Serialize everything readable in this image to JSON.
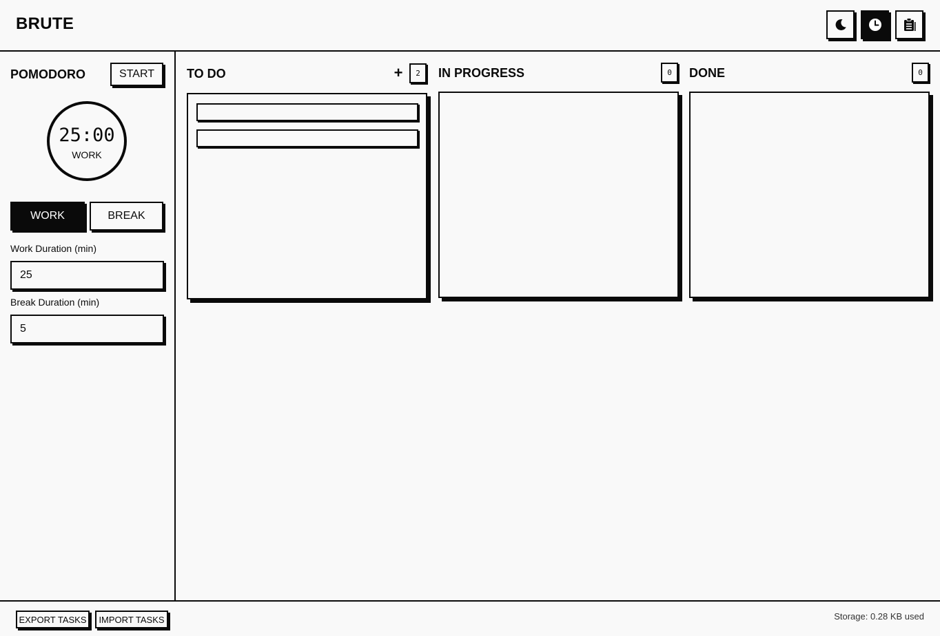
{
  "app": {
    "title": "BRUTE"
  },
  "header": {
    "buttons": [
      {
        "name": "dark-mode-toggle",
        "icon": "moon-icon"
      },
      {
        "name": "pomodoro-toggle",
        "icon": "clock-icon",
        "active": true
      },
      {
        "name": "clipboard-button",
        "icon": "clipboard-icon"
      }
    ]
  },
  "pomodoro": {
    "title": "POMODORO",
    "start_label": "START",
    "time": "25:00",
    "mode": "WORK",
    "work_label": "WORK",
    "break_label": "BREAK",
    "work_duration_label": "Work Duration (min)",
    "work_duration_value": "25",
    "break_duration_label": "Break Duration (min)",
    "break_duration_value": "5"
  },
  "board": {
    "add_icon": "+",
    "columns": [
      {
        "title": "TO DO",
        "count": "2"
      },
      {
        "title": "IN PROGRESS",
        "count": "0"
      },
      {
        "title": "DONE",
        "count": "0"
      }
    ]
  },
  "footer": {
    "export_label": "EXPORT TASKS",
    "import_label": "IMPORT TASKS",
    "storage": "Storage: 0.28 KB used"
  },
  "colors": {
    "ink": "#0a0a0a",
    "background": "#f9f9f9"
  }
}
